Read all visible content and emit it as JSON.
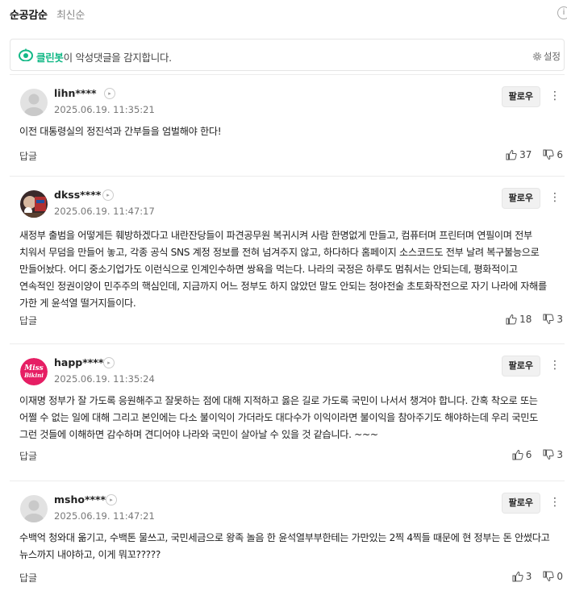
{
  "sort": {
    "active": "순공감순",
    "inactive": "최신순"
  },
  "cleanbot": {
    "brand": "클린봇",
    "message": "이 악성댓글을 감지합니다.",
    "settings_label": "설정"
  },
  "comments": [
    {
      "user": "lihn****",
      "date": "2025.06.19. 11:35:21",
      "follow": "팔로우",
      "text": "이전 대통령실의 정진석과 간부들을 엄벌해야 한다!",
      "reply": "답글",
      "likes": "37",
      "dislikes": "6",
      "avatar": "default"
    },
    {
      "user": "dkss****",
      "date": "2025.06.19. 11:47:17",
      "follow": "팔로우",
      "text": "새정부 출범을 어떻게든 훼방하겠다고 내란잔당들이 파견공무원 복귀시켜 사람 한명없게 만들고, 컴퓨터며 프린터며 연필이며 전부 치워서 무덤을 만들어 놓고, 각종 공식 SNS 계정 정보를 전혀 넘겨주지 않고, 하다하다 홈페이지 소스코드도 전부 날려 복구불능으로 만들어놨다. 어디 중소기업가도 이런식으로 인계인수하면 쌍욕을 먹는다. 나라의 국정은 하루도 멈춰서는 안되는데, 평화적이고 연속적인 정권이양이 민주주의 핵심인데, 지금까지 어느 정부도 하지 않았던 말도 안되는 청야전술 초토화작전으로 자기 나라에 자해를 가한 게 윤석열 떨거지들이다.",
      "reply": "답글",
      "likes": "18",
      "dislikes": "3",
      "avatar": "photo"
    },
    {
      "user": "happ****",
      "date": "2025.06.19. 11:35:24",
      "follow": "팔로우",
      "text": "이재명 정부가 잘 가도록 응원해주고 잘못하는 점에 대해 지적하고 옳은 길로 가도록 국민이 나서서 챙겨야 합니다. 간혹 착오로 또는 어쩔 수 없는 일에 대해 그리고 본인에는 다소 불이익이 가더라도 대다수가 이익이라면 불이익을 참아주기도 해야하는데 우리 국민도 그런 것들에 이해하면 감수하며 견디어야 나라와 국민이 살아날 수 있을 것 같습니다. ~~~",
      "reply": "답글",
      "likes": "6",
      "dislikes": "3",
      "avatar": "missbikini",
      "avatar_text_1": "Miss",
      "avatar_text_2": "Bikini"
    },
    {
      "user": "msho****",
      "date": "2025.06.19. 11:47:21",
      "follow": "팔로우",
      "text": "수백억 청와대 옮기고, 수백톤 물쓰고, 국민세금으로 왕족 놀음 한 윤석열부부한테는 가만있는 2찍 4찍들 때문에 현 정부는 돈 안썼다고 뉴스까지 내야하고, 이게 뭐꼬?????",
      "reply": "답글",
      "likes": "3",
      "dislikes": "0",
      "avatar": "default"
    }
  ],
  "colors": {
    "cleanbot_green": "#12b886",
    "avatar_default": "#c9c9c9",
    "missbikini_bg": "#e61e64"
  }
}
